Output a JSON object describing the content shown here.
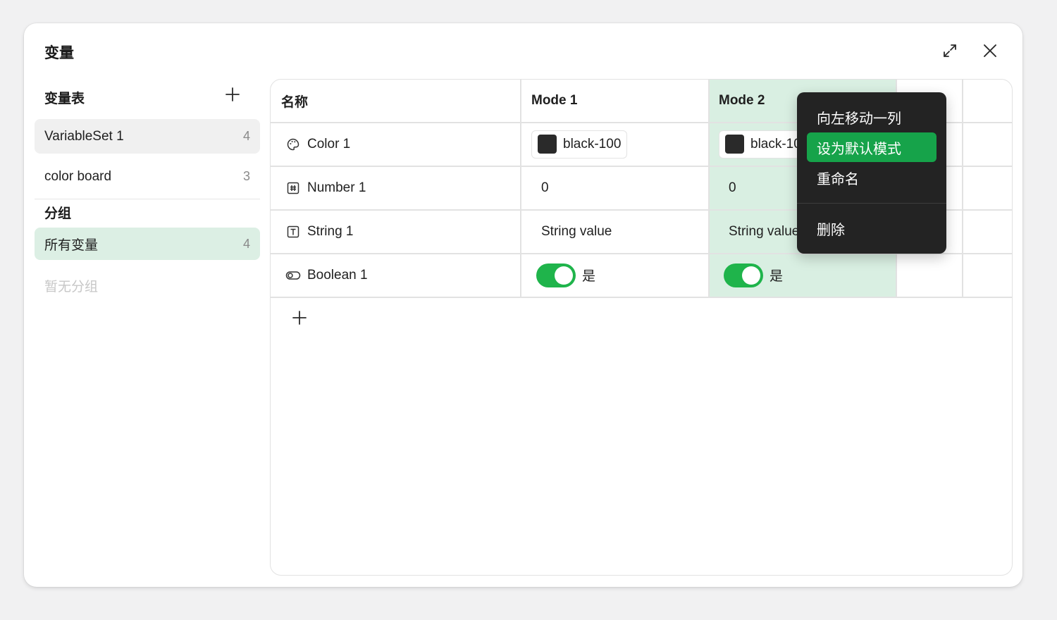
{
  "dialog": {
    "title": "变量"
  },
  "sidebar": {
    "sets_heading": "变量表",
    "sets": [
      {
        "label": "VariableSet 1",
        "count": "4",
        "selected": true
      },
      {
        "label": "color board",
        "count": "3",
        "selected": false
      }
    ],
    "groups_heading": "分组",
    "groups": [
      {
        "label": "所有变量",
        "count": "4",
        "selected": true
      }
    ],
    "empty_groups": "暂无分组"
  },
  "table": {
    "headers": {
      "name": "名称",
      "mode1": "Mode 1",
      "mode2": "Mode 2"
    },
    "rows": [
      {
        "name": "Color 1",
        "type_icon": "palette-icon",
        "mode1": "black-100",
        "mode2": "black-100",
        "swatch": "#2a2a2a"
      },
      {
        "name": "Number 1",
        "type_icon": "hash-icon",
        "mode1": "0",
        "mode2": "0"
      },
      {
        "name": "String 1",
        "type_icon": "text-icon",
        "mode1": "String value",
        "mode2": "String value"
      },
      {
        "name": "Boolean 1",
        "type_icon": "toggle-icon",
        "mode1": "是",
        "mode2": "是",
        "mode1_on": true,
        "mode2_on": true
      }
    ]
  },
  "context_menu": {
    "items": [
      "向左移动一列",
      "设为默认模式",
      "重命名",
      "删除"
    ],
    "active_index": 1
  },
  "colors": {
    "accent": "#16a34a",
    "toggle_on": "#1fb44b",
    "column_highlight": "#d9efe2",
    "sidebar_selected_group": "#dcefe4",
    "sidebar_selected_set": "#f0f0f0",
    "menu_bg": "#232323"
  }
}
